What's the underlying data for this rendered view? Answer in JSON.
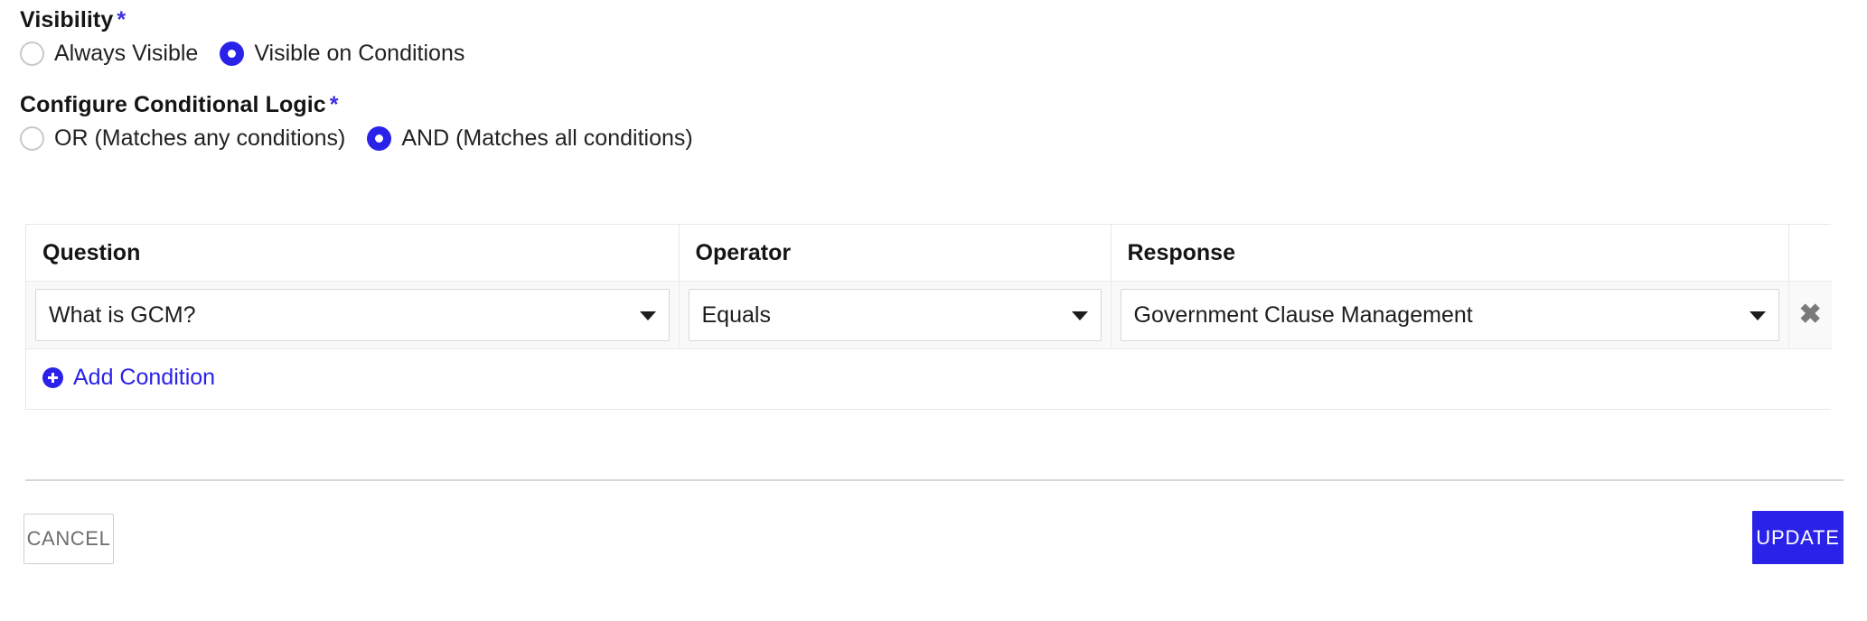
{
  "visibility": {
    "label": "Visibility",
    "required_marker": "*",
    "options": [
      {
        "label": "Always Visible",
        "selected": false
      },
      {
        "label": "Visible on Conditions",
        "selected": true
      }
    ]
  },
  "conditional_logic": {
    "label": "Configure Conditional Logic",
    "required_marker": "*",
    "options": [
      {
        "label": "OR (Matches any conditions)",
        "selected": false
      },
      {
        "label": "AND (Matches all conditions)",
        "selected": true
      }
    ]
  },
  "conditions_table": {
    "columns": [
      "Question",
      "Operator",
      "Response",
      ""
    ],
    "rows": [
      {
        "question": "What is GCM?",
        "operator": "Equals",
        "response": "Government Clause Management",
        "remove_label": "✖"
      }
    ],
    "add_condition_label": "Add Condition"
  },
  "footer": {
    "cancel_label": "CANCEL",
    "update_label": "UPDATE"
  },
  "colors": {
    "accent": "#2a22e8",
    "required": "#3b2fe0",
    "row_background": "#f9f9f9",
    "border": "#e6e6e6",
    "cancel_text": "#6e6e6e"
  }
}
